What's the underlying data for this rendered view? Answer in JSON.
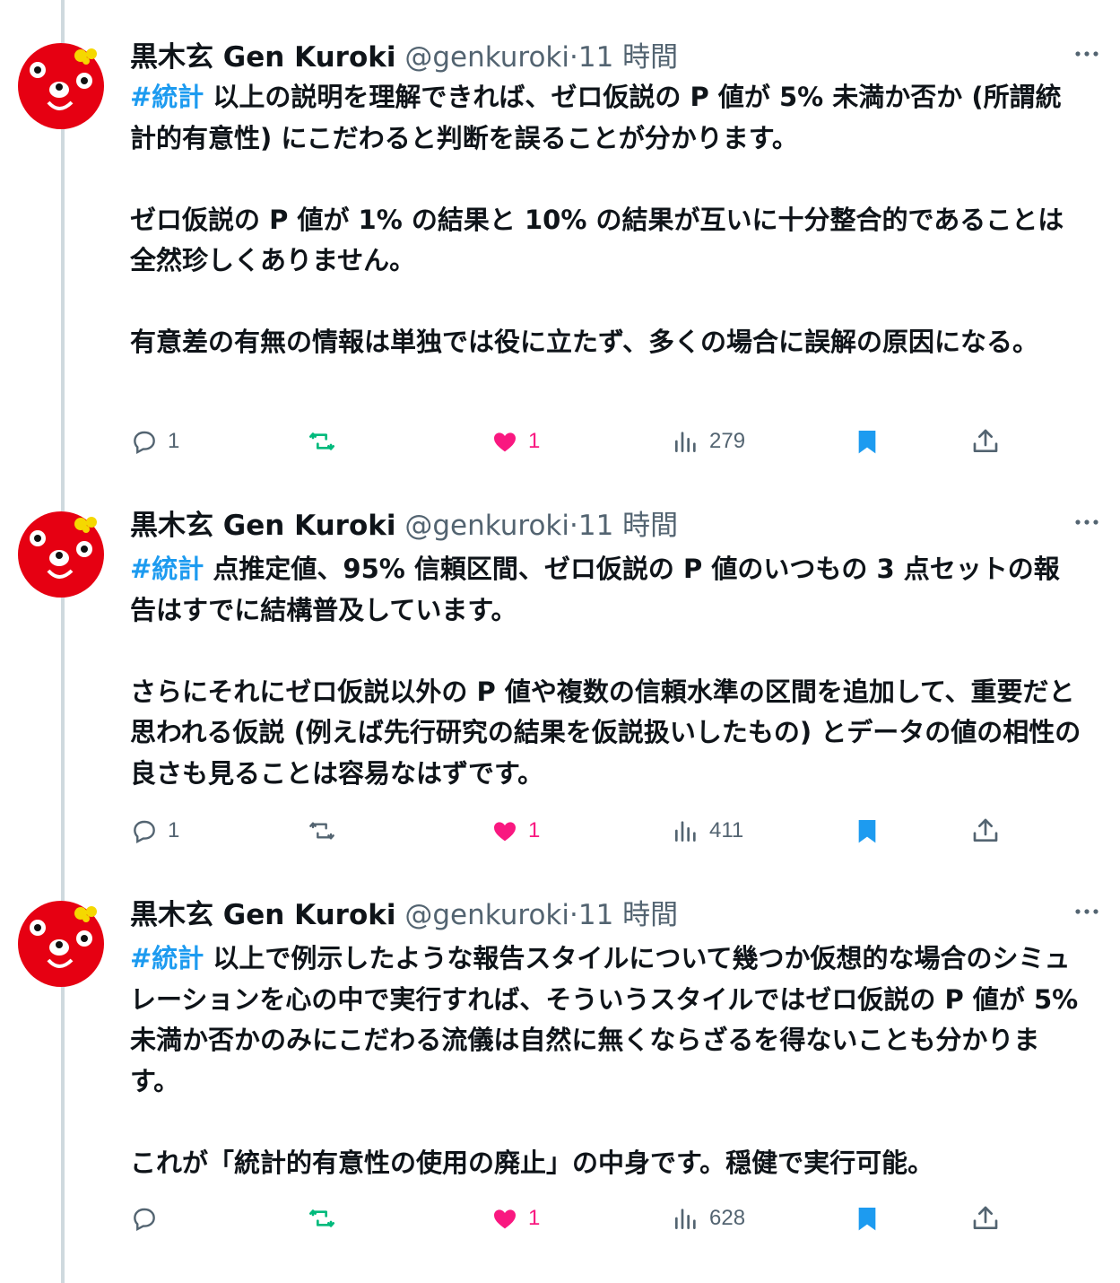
{
  "colors": {
    "accent": "#1d9bf0",
    "retweet_green": "#00ba7c",
    "like_pink": "#f91880",
    "muted": "#536471",
    "avatar_red": "#e60012"
  },
  "tweets": [
    {
      "name": "黒木玄 Gen Kuroki",
      "handle": "@genkuroki",
      "dot": "·",
      "time": "11 時間",
      "hashtag": "#統計",
      "para1": " 以上の説明を理解できれば、ゼロ仮説の P 値が 5% 未満か否か (所謂統計的有意性) にこだわると判断を誤ることが分かります。",
      "para2": "ゼロ仮説の P 値が 1% の結果と 10% の結果が互いに十分整合的であることは全然珍しくありません。",
      "para3": "有意差の有無の情報は単独では役に立たず、多くの場合に誤解の原因になる。",
      "replies": "1",
      "retweets": "",
      "likes": "1",
      "views": "279",
      "retweet_active": true,
      "like_active": true,
      "bookmark_active": true
    },
    {
      "name": "黒木玄 Gen Kuroki",
      "handle": "@genkuroki",
      "dot": "·",
      "time": "11 時間",
      "hashtag": "#統計",
      "para1": " 点推定値、95% 信頼区間、ゼロ仮説の P 値のいつもの 3 点セットの報告はすでに結構普及しています。",
      "para2": "さらにそれにゼロ仮説以外の P 値や複数の信頼水準の区間を追加して、重要だと思われる仮説 (例えば先行研究の結果を仮説扱いしたもの) とデータの値の相性の良さも見ることは容易なはずです。",
      "para3": "",
      "replies": "1",
      "retweets": "",
      "likes": "1",
      "views": "411",
      "retweet_active": false,
      "like_active": true,
      "bookmark_active": true
    },
    {
      "name": "黒木玄 Gen Kuroki",
      "handle": "@genkuroki",
      "dot": "·",
      "time": "11 時間",
      "hashtag": "#統計",
      "para1": " 以上で例示したような報告スタイルについて幾つか仮想的な場合のシミュレーションを心の中で実行すれば、そういうスタイルではゼロ仮説の P 値が 5% 未満か否かのみにこだわる流儀は自然に無くならざるを得ないことも分かります。",
      "para2": "これが「統計的有意性の使用の廃止」の中身です。穏健で実行可能。",
      "para3": "",
      "replies": "",
      "retweets": "",
      "likes": "1",
      "views": "628",
      "retweet_active": true,
      "like_active": true,
      "bookmark_active": true
    }
  ]
}
